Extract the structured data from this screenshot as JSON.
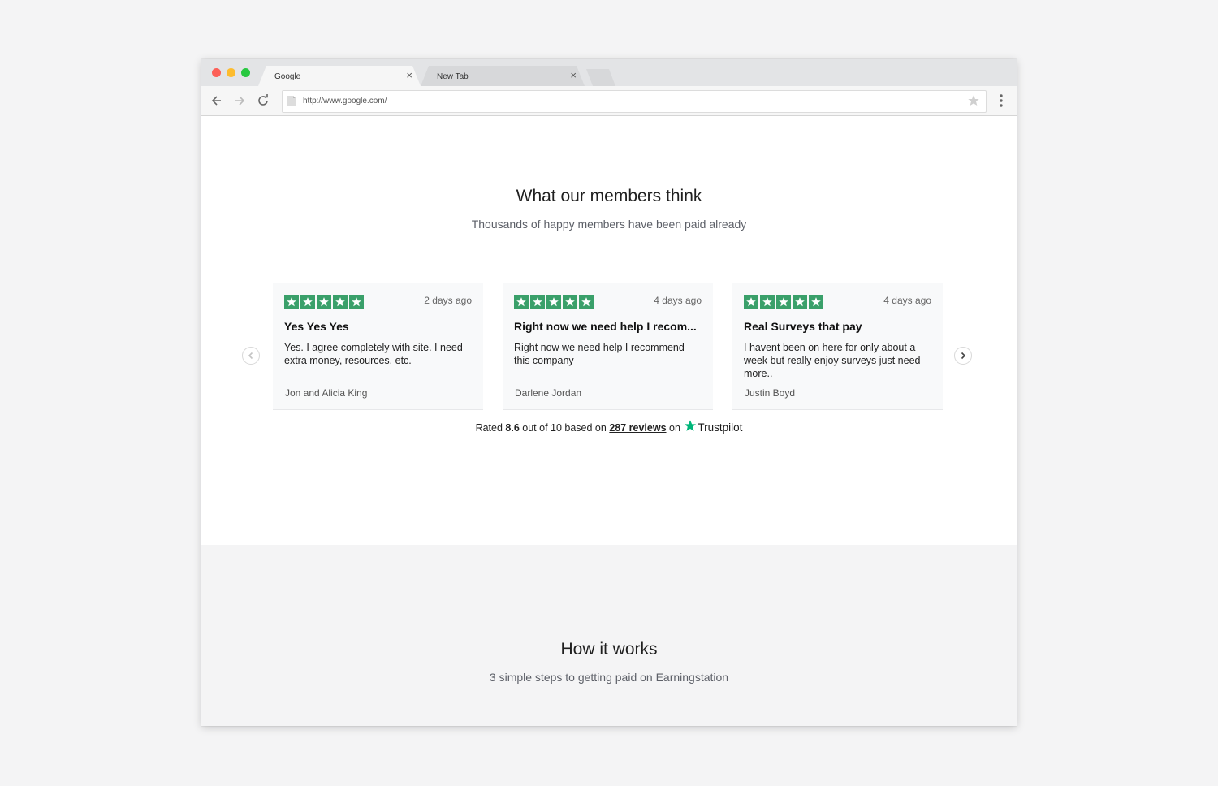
{
  "browser": {
    "tabs": [
      {
        "title": "Google",
        "close": "×"
      },
      {
        "title": "New Tab",
        "close": "×"
      }
    ],
    "url": "http://www.google.com/",
    "icons": [
      "back-arrow-icon",
      "forward-arrow-icon",
      "reload-icon",
      "page-icon",
      "bookmark-star-icon",
      "menu-dots-icon"
    ]
  },
  "reviews": {
    "heading": "What our members think",
    "subheading": "Thousands of happy members have been paid already",
    "cards": [
      {
        "stars": 5,
        "time": "2 days ago",
        "title": "Yes Yes Yes",
        "body": "Yes. I agree completely with site. I need extra money, resources, etc.",
        "author": "Jon and Alicia King"
      },
      {
        "stars": 5,
        "time": "4 days ago",
        "title": "Right now we need help I recom...",
        "body": "Right now we need help I recommend this company",
        "author": "Darlene Jordan"
      },
      {
        "stars": 5,
        "time": "4 days ago",
        "title": "Real Surveys that pay",
        "body": "I havent been on here for only about a week but really enjoy surveys just need more..",
        "author": "Justin Boyd"
      }
    ],
    "rating": {
      "prefix": "Rated",
      "score": "8.6",
      "mid": "out of 10 based on",
      "reviews_link": "287 reviews",
      "on": "on",
      "brand": "Trustpilot"
    },
    "colors": {
      "star_green": "#3aa06a",
      "trustpilot_green": "#00b67a"
    }
  },
  "how_it_works": {
    "heading": "How it works",
    "subheading": "3 simple steps to getting paid on Earningstation"
  }
}
